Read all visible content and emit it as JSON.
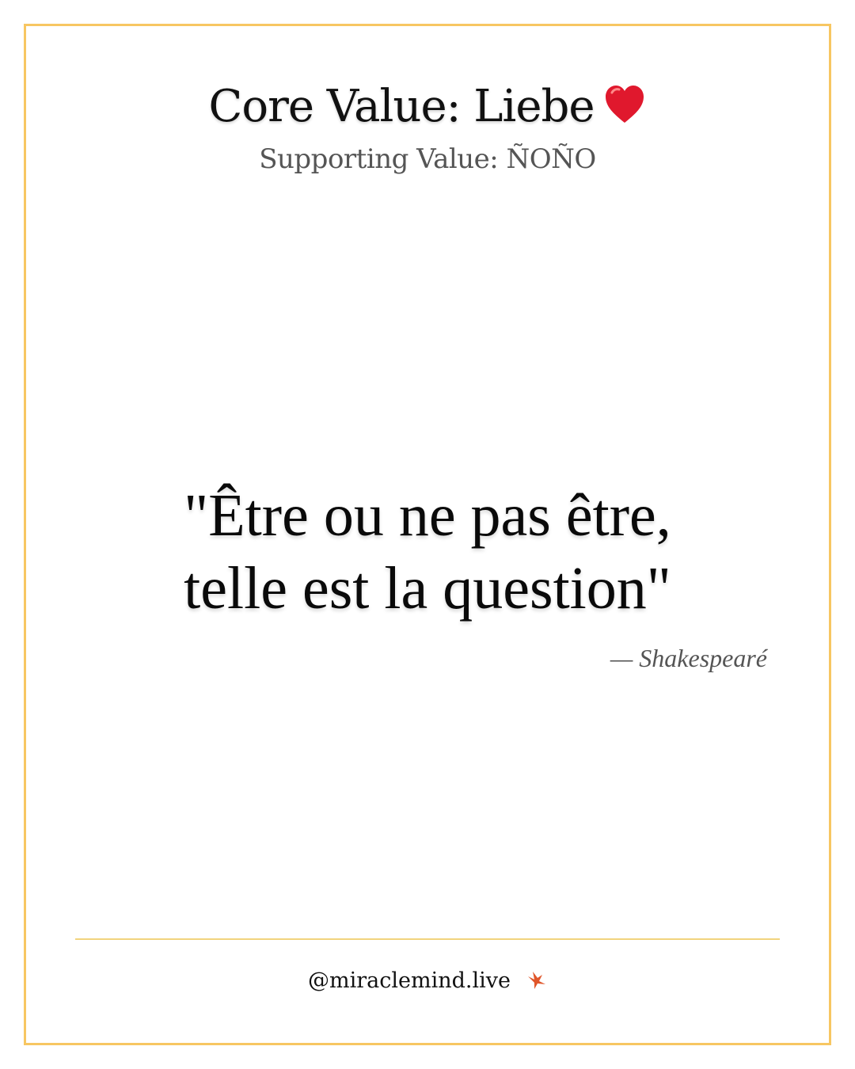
{
  "header": {
    "title": "Core Value: Liebe",
    "title_icon": "heart-icon",
    "subtitle": "Supporting Value: ÑOÑO"
  },
  "quote": {
    "line1": "\"Être ou ne pas être,",
    "line2": "telle est la question\"",
    "author": "— Shakespearé"
  },
  "footer": {
    "handle": "@miraclemind.live",
    "icon": "bird-icon"
  },
  "colors": {
    "border": "#f7c662",
    "divider": "#f2d47e",
    "heart": "#e0182d",
    "bird": "#e0562a"
  }
}
